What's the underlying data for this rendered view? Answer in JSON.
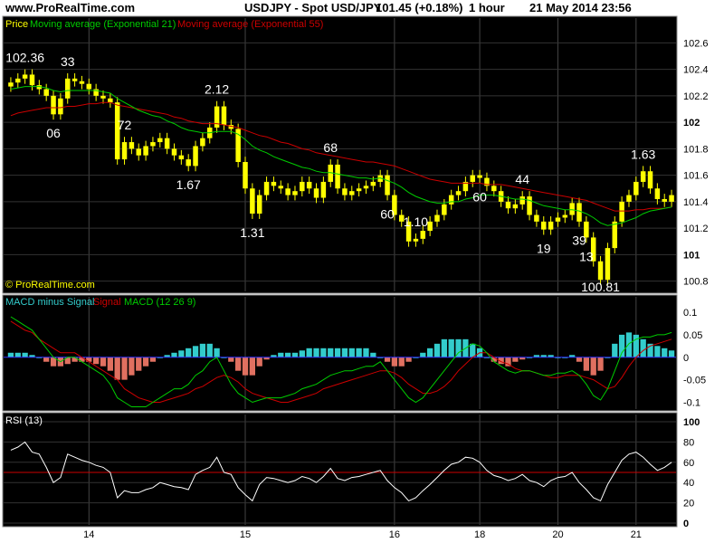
{
  "header": {
    "url": "www.ProRealTime.com",
    "symbol": "USDJPY - Spot USD/JPY",
    "last": "101.45 (+0.18%)",
    "timeframe": "1 hour",
    "datetime": "21 May 2014 23:56"
  },
  "colors": {
    "background": "#000000",
    "price": "#ffff00",
    "ema21": "#00cc00",
    "ema55": "#cc0000",
    "hist_pos": "#33cccc",
    "hist_neg": "#e07060",
    "rsi": "#ffffff",
    "rsi_ref": "#cc0000",
    "zero_line": "#3333ff"
  },
  "panels": {
    "price": {
      "legend_price": "Price",
      "legend_ema21": "Moving average (Exponential 21)",
      "legend_ema55": "Moving average (Exponential 55)",
      "copyright": "© ProRealTime.com",
      "y_ticks": [
        "102.6",
        "102.4",
        "102.2",
        "102",
        "101.8",
        "101.6",
        "101.4",
        "101.2",
        "101",
        "100.8"
      ]
    },
    "macd": {
      "legend_hist": "MACD minus Signal",
      "legend_signal": "Signal",
      "legend_macd": "MACD (12 26 9)",
      "y_ticks": [
        "0.1",
        "0.05",
        "0",
        "-0.05",
        "-0.1"
      ]
    },
    "rsi": {
      "legend": "RSI (13)",
      "y_ticks": [
        "100",
        "80",
        "60",
        "40",
        "20",
        "0"
      ]
    }
  },
  "x_ticks": [
    "14",
    "15",
    "16",
    "18",
    "20",
    "21"
  ],
  "annotations": [
    {
      "label": "102.36",
      "bar": 2
    },
    {
      "label": "33",
      "bar": 8
    },
    {
      "label": "06",
      "bar": 6
    },
    {
      "label": "72",
      "bar": 16
    },
    {
      "label": "1.67",
      "bar": 25
    },
    {
      "label": "2.12",
      "bar": 29
    },
    {
      "label": "1.31",
      "bar": 34
    },
    {
      "label": "68",
      "bar": 45
    },
    {
      "label": "60",
      "bar": 53
    },
    {
      "label": "1.10",
      "bar": 57
    },
    {
      "label": "60",
      "bar": 66
    },
    {
      "label": "44",
      "bar": 72
    },
    {
      "label": "19",
      "bar": 75
    },
    {
      "label": "39",
      "bar": 80
    },
    {
      "label": "13",
      "bar": 81
    },
    {
      "label": "100.81",
      "bar": 83
    },
    {
      "label": "1.63",
      "bar": 89
    }
  ],
  "chart_data": {
    "type": "candlestick",
    "ylim_price": [
      100.75,
      102.65
    ],
    "ylim_macd": [
      -0.115,
      0.11
    ],
    "ylim_rsi": [
      0,
      100
    ],
    "rsi_reference": 50,
    "close": [
      102.3,
      102.33,
      102.36,
      102.28,
      102.25,
      102.2,
      102.06,
      102.18,
      102.33,
      102.31,
      102.29,
      102.25,
      102.2,
      102.18,
      102.15,
      101.72,
      101.85,
      101.8,
      101.75,
      101.82,
      101.85,
      101.88,
      101.8,
      101.75,
      101.72,
      101.67,
      101.82,
      101.88,
      101.96,
      102.12,
      101.98,
      101.95,
      101.7,
      101.5,
      101.31,
      101.45,
      101.55,
      101.52,
      101.5,
      101.45,
      101.48,
      101.55,
      101.5,
      101.43,
      101.55,
      101.68,
      101.5,
      101.45,
      101.48,
      101.5,
      101.52,
      101.55,
      101.6,
      101.45,
      101.3,
      101.25,
      101.1,
      101.12,
      101.18,
      101.25,
      101.3,
      101.38,
      101.45,
      101.48,
      101.55,
      101.6,
      101.58,
      101.52,
      101.48,
      101.4,
      101.35,
      101.38,
      101.44,
      101.3,
      101.25,
      101.19,
      101.25,
      101.28,
      101.3,
      101.39,
      101.25,
      101.13,
      100.95,
      100.81,
      101.05,
      101.25,
      101.4,
      101.45,
      101.55,
      101.63,
      101.5,
      101.42,
      101.4,
      101.45
    ],
    "ema21": [
      102.25,
      102.26,
      102.27,
      102.27,
      102.27,
      102.26,
      102.24,
      102.23,
      102.24,
      102.24,
      102.24,
      102.24,
      102.24,
      102.23,
      102.22,
      102.18,
      102.15,
      102.12,
      102.09,
      102.07,
      102.05,
      102.04,
      102.01,
      101.99,
      101.96,
      101.94,
      101.93,
      101.92,
      101.92,
      101.93,
      101.93,
      101.93,
      101.91,
      101.87,
      101.82,
      101.79,
      101.77,
      101.74,
      101.72,
      101.7,
      101.68,
      101.66,
      101.65,
      101.63,
      101.62,
      101.62,
      101.61,
      101.6,
      101.59,
      101.58,
      101.58,
      101.57,
      101.58,
      101.56,
      101.54,
      101.51,
      101.47,
      101.44,
      101.42,
      101.4,
      101.39,
      101.39,
      101.4,
      101.4,
      101.42,
      101.43,
      101.45,
      101.45,
      101.45,
      101.44,
      101.43,
      101.42,
      101.42,
      101.41,
      101.39,
      101.37,
      101.36,
      101.35,
      101.34,
      101.34,
      101.33,
      101.31,
      101.28,
      101.24,
      101.22,
      101.23,
      101.24,
      101.26,
      101.28,
      101.31,
      101.33,
      101.34,
      101.35,
      101.36
    ],
    "ema55": [
      102.05,
      102.07,
      102.08,
      102.09,
      102.1,
      102.11,
      102.11,
      102.11,
      102.12,
      102.12,
      102.13,
      102.14,
      102.14,
      102.15,
      102.15,
      102.13,
      102.12,
      102.11,
      102.1,
      102.09,
      102.08,
      102.07,
      102.06,
      102.04,
      102.03,
      102.01,
      102.0,
      101.99,
      101.99,
      101.99,
      101.98,
      101.97,
      101.96,
      101.94,
      101.92,
      101.9,
      101.89,
      101.87,
      101.85,
      101.84,
      101.82,
      101.8,
      101.79,
      101.77,
      101.76,
      101.75,
      101.74,
      101.73,
      101.72,
      101.71,
      101.7,
      101.7,
      101.69,
      101.68,
      101.67,
      101.65,
      101.63,
      101.61,
      101.59,
      101.57,
      101.56,
      101.55,
      101.54,
      101.54,
      101.54,
      101.54,
      101.54,
      101.53,
      101.53,
      101.53,
      101.52,
      101.51,
      101.5,
      101.49,
      101.48,
      101.47,
      101.46,
      101.45,
      101.44,
      101.43,
      101.42,
      101.41,
      101.39,
      101.37,
      101.35,
      101.33,
      101.33,
      101.33,
      101.34,
      101.34,
      101.35,
      101.35,
      101.35,
      101.36
    ],
    "macd_hist": [
      0.01,
      0.01,
      0.01,
      0.005,
      0.0,
      -0.01,
      -0.02,
      -0.02,
      -0.015,
      -0.01,
      -0.01,
      -0.01,
      -0.015,
      -0.02,
      -0.03,
      -0.05,
      -0.05,
      -0.04,
      -0.03,
      -0.02,
      -0.01,
      0.0,
      0.005,
      0.01,
      0.015,
      0.02,
      0.025,
      0.03,
      0.03,
      0.02,
      0.0,
      -0.01,
      -0.03,
      -0.04,
      -0.04,
      -0.02,
      -0.005,
      0.005,
      0.01,
      0.01,
      0.01,
      0.015,
      0.02,
      0.02,
      0.02,
      0.02,
      0.02,
      0.02,
      0.02,
      0.02,
      0.02,
      0.01,
      0.0,
      -0.01,
      -0.02,
      -0.02,
      -0.01,
      0.0,
      0.01,
      0.02,
      0.03,
      0.04,
      0.04,
      0.04,
      0.04,
      0.03,
      0.02,
      0.0,
      -0.01,
      -0.015,
      -0.02,
      -0.01,
      -0.005,
      0.0,
      0.005,
      0.005,
      0.005,
      0.0,
      0.0,
      0.005,
      -0.01,
      -0.03,
      -0.04,
      -0.03,
      0.0,
      0.03,
      0.05,
      0.055,
      0.05,
      0.04,
      0.03,
      0.025,
      0.02,
      0.015
    ],
    "macd": [
      0.09,
      0.08,
      0.07,
      0.06,
      0.04,
      0.02,
      0.0,
      -0.01,
      0.0,
      0.0,
      -0.01,
      -0.02,
      -0.03,
      -0.04,
      -0.06,
      -0.09,
      -0.1,
      -0.11,
      -0.11,
      -0.11,
      -0.1,
      -0.09,
      -0.08,
      -0.07,
      -0.07,
      -0.06,
      -0.04,
      -0.03,
      -0.01,
      0.0,
      -0.03,
      -0.06,
      -0.08,
      -0.09,
      -0.1,
      -0.095,
      -0.09,
      -0.09,
      -0.09,
      -0.085,
      -0.08,
      -0.07,
      -0.065,
      -0.06,
      -0.05,
      -0.04,
      -0.035,
      -0.03,
      -0.03,
      -0.025,
      -0.02,
      -0.02,
      -0.01,
      -0.03,
      -0.05,
      -0.07,
      -0.09,
      -0.1,
      -0.09,
      -0.07,
      -0.05,
      -0.03,
      -0.01,
      0.01,
      0.02,
      0.03,
      0.025,
      0.01,
      -0.01,
      -0.02,
      -0.03,
      -0.035,
      -0.03,
      -0.03,
      -0.035,
      -0.04,
      -0.04,
      -0.035,
      -0.035,
      -0.03,
      -0.04,
      -0.06,
      -0.085,
      -0.095,
      -0.07,
      -0.03,
      0.01,
      0.03,
      0.04,
      0.045,
      0.045,
      0.05,
      0.05,
      0.055
    ],
    "macd_signal": [
      0.08,
      0.07,
      0.06,
      0.055,
      0.04,
      0.03,
      0.02,
      0.01,
      0.01,
      0.01,
      0.0,
      -0.01,
      -0.02,
      -0.03,
      -0.04,
      -0.05,
      -0.07,
      -0.08,
      -0.09,
      -0.095,
      -0.1,
      -0.1,
      -0.095,
      -0.09,
      -0.085,
      -0.08,
      -0.07,
      -0.065,
      -0.055,
      -0.045,
      -0.04,
      -0.045,
      -0.055,
      -0.07,
      -0.08,
      -0.085,
      -0.09,
      -0.095,
      -0.1,
      -0.1,
      -0.095,
      -0.09,
      -0.085,
      -0.08,
      -0.07,
      -0.065,
      -0.06,
      -0.055,
      -0.05,
      -0.045,
      -0.04,
      -0.035,
      -0.03,
      -0.03,
      -0.035,
      -0.045,
      -0.06,
      -0.07,
      -0.08,
      -0.08,
      -0.075,
      -0.065,
      -0.05,
      -0.03,
      -0.015,
      0.0,
      0.01,
      0.01,
      0.0,
      -0.01,
      -0.015,
      -0.025,
      -0.03,
      -0.03,
      -0.035,
      -0.04,
      -0.045,
      -0.045,
      -0.04,
      -0.04,
      -0.04,
      -0.045,
      -0.05,
      -0.06,
      -0.07,
      -0.065,
      -0.045,
      -0.02,
      0.0,
      0.015,
      0.025,
      0.03,
      0.035,
      0.04
    ],
    "rsi": [
      72,
      75,
      80,
      70,
      68,
      55,
      40,
      45,
      68,
      65,
      62,
      60,
      57,
      55,
      50,
      25,
      32,
      30,
      30,
      33,
      35,
      40,
      38,
      36,
      35,
      33,
      48,
      52,
      55,
      65,
      50,
      48,
      35,
      28,
      22,
      38,
      45,
      44,
      42,
      40,
      42,
      46,
      44,
      40,
      46,
      54,
      44,
      42,
      45,
      46,
      48,
      50,
      52,
      42,
      35,
      30,
      22,
      25,
      32,
      38,
      45,
      52,
      58,
      60,
      65,
      64,
      60,
      52,
      47,
      45,
      42,
      44,
      48,
      42,
      40,
      36,
      42,
      45,
      46,
      50,
      40,
      33,
      25,
      22,
      38,
      50,
      62,
      68,
      70,
      65,
      58,
      52,
      55,
      60
    ]
  }
}
